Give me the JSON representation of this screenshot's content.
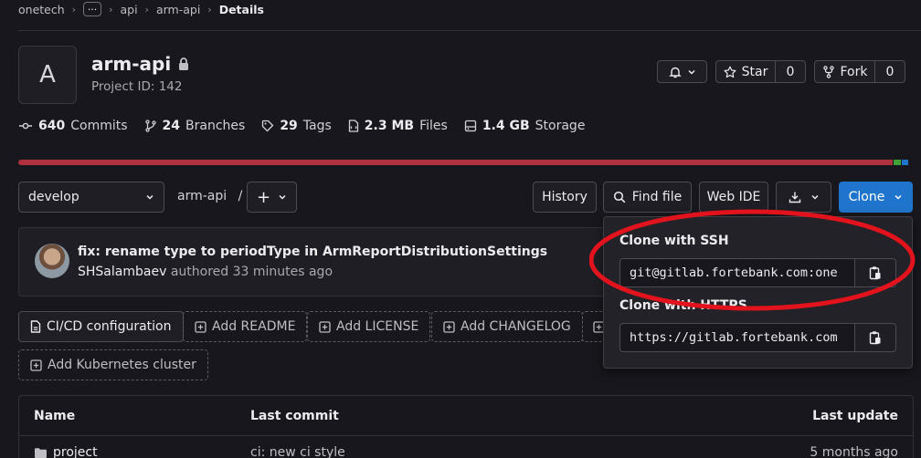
{
  "breadcrumb": {
    "group": "onetech",
    "ellipsis": "···",
    "subgroup": "api",
    "project": "arm-api",
    "current": "Details"
  },
  "project": {
    "avatar_letter": "A",
    "name": "arm-api",
    "id_text": "Project ID: 142",
    "lock_icon": "lock-icon"
  },
  "actions": {
    "notifications_icon": "bell-icon",
    "star_label": "Star",
    "star_count": "0",
    "fork_label": "Fork",
    "fork_count": "0"
  },
  "stats": [
    {
      "icon": "commit-icon",
      "value": "640",
      "label": "Commits"
    },
    {
      "icon": "branch-icon",
      "value": "24",
      "label": "Branches"
    },
    {
      "icon": "tag-icon",
      "value": "29",
      "label": "Tags"
    },
    {
      "icon": "file-icon",
      "value": "2.3 MB",
      "label": "Files"
    },
    {
      "icon": "storage-icon",
      "value": "1.4 GB",
      "label": "Storage"
    }
  ],
  "language_bar": [
    {
      "share": 0.98,
      "color": "#b0313e"
    },
    {
      "share": 0.008,
      "color": "#3fa33a"
    },
    {
      "share": 0.007,
      "color": "#1f75cb"
    }
  ],
  "toolbar": {
    "branch": "develop",
    "path_root": "arm-api",
    "path_sep": "/",
    "add_label": "+",
    "history": "History",
    "find_file": "Find file",
    "web_ide": "Web IDE",
    "clone": "Clone"
  },
  "last_commit": {
    "title": "fix: rename type to periodType in ArmReportDistributionSettings",
    "author": "SHSalambaev",
    "meta": "authored 33 minutes ago"
  },
  "quick_actions": {
    "cicd": "CI/CD configuration",
    "readme": "Add README",
    "license": "Add LICENSE",
    "changelog": "Add CHANGELOG",
    "kubernetes": "Add Kubernetes cluster"
  },
  "table": {
    "headers": {
      "name": "Name",
      "last_commit": "Last commit",
      "last_update": "Last update"
    },
    "rows": [
      {
        "name": "project",
        "commit": "ci: new ci style",
        "update": "5 months ago"
      }
    ]
  },
  "clone_dropdown": {
    "ssh_label": "Clone with SSH",
    "ssh_url": "git@gitlab.fortebank.com:one",
    "https_label": "Clone with HTTPS",
    "https_url": "https://gitlab.fortebank.com"
  },
  "colors": {
    "accent": "#1f75cb",
    "annotation": "#e2131c",
    "background": "#18171d"
  }
}
